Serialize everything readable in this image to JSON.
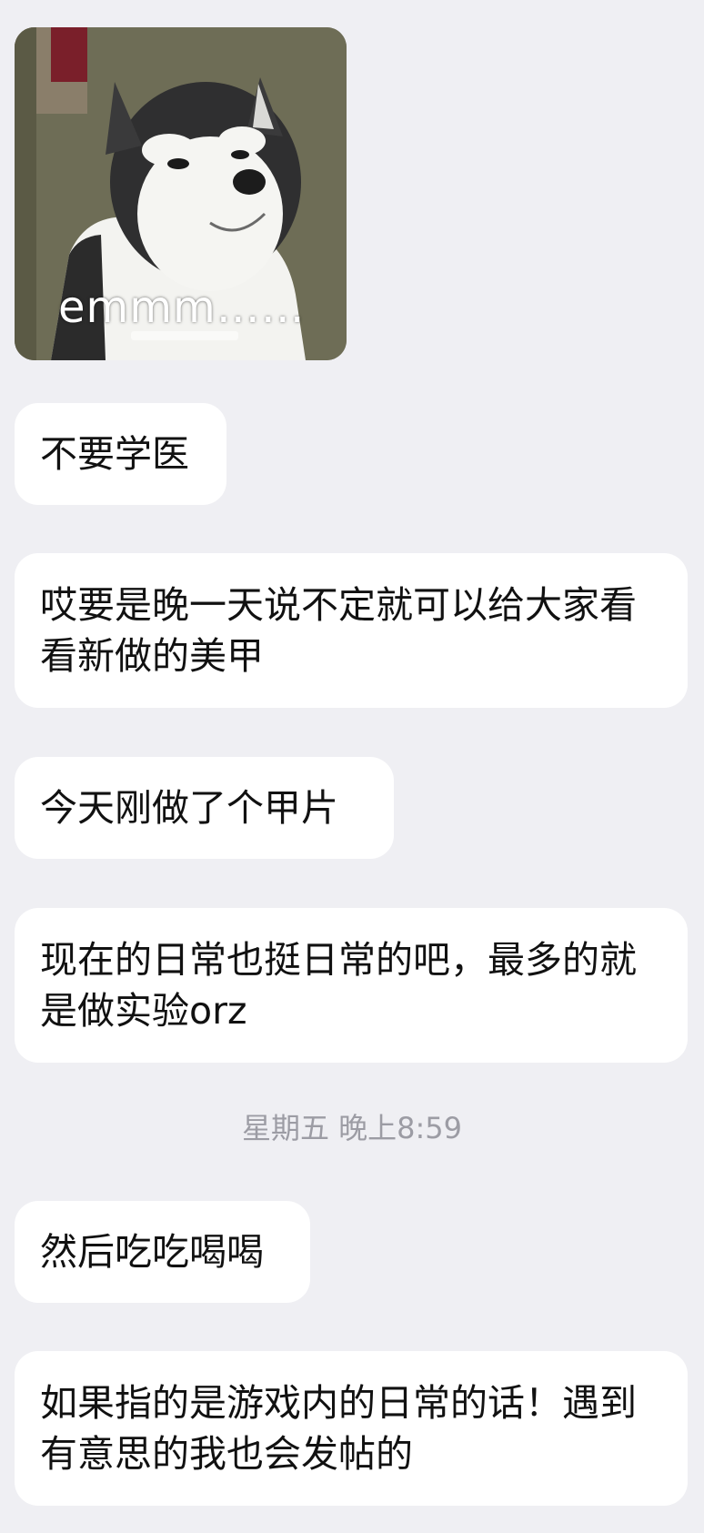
{
  "sticker": {
    "caption": "emmm……",
    "subject": "husky-meme-sticker"
  },
  "messages": [
    {
      "text": "不要学医"
    },
    {
      "text": "哎要是晚一天说不定就可以给大家看看新做的美甲"
    },
    {
      "text": "今天刚做了个甲片"
    },
    {
      "text": "现在的日常也挺日常的吧，最多的就是做实验orz"
    },
    {
      "text": "然后吃吃喝喝"
    },
    {
      "text": "如果指的是游戏内的日常的话！遇到有意思的我也会发帖的"
    }
  ],
  "timestamp": "星期五 晚上8:59",
  "colors": {
    "background": "#efeff3",
    "bubble": "#ffffff",
    "text": "#111111",
    "timestamp": "#9c9ca4"
  }
}
